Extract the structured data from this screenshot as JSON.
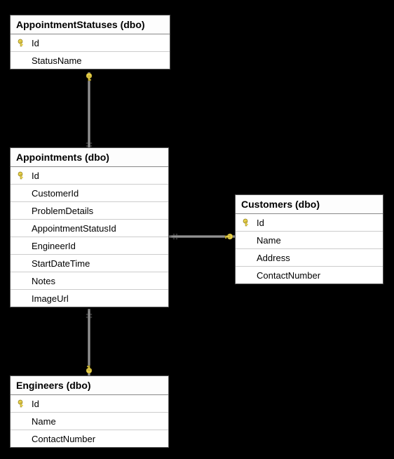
{
  "tables": {
    "appointmentStatuses": {
      "title": "AppointmentStatuses (dbo)",
      "columns": [
        {
          "name": "Id",
          "pk": true
        },
        {
          "name": "StatusName",
          "pk": false
        }
      ]
    },
    "appointments": {
      "title": "Appointments (dbo)",
      "columns": [
        {
          "name": "Id",
          "pk": true
        },
        {
          "name": "CustomerId",
          "pk": false
        },
        {
          "name": "ProblemDetails",
          "pk": false
        },
        {
          "name": "AppointmentStatusId",
          "pk": false
        },
        {
          "name": "EngineerId",
          "pk": false
        },
        {
          "name": "StartDateTime",
          "pk": false
        },
        {
          "name": "Notes",
          "pk": false
        },
        {
          "name": "ImageUrl",
          "pk": false
        }
      ]
    },
    "customers": {
      "title": "Customers (dbo)",
      "columns": [
        {
          "name": "Id",
          "pk": true
        },
        {
          "name": "Name",
          "pk": false
        },
        {
          "name": "Address",
          "pk": false
        },
        {
          "name": "ContactNumber",
          "pk": false
        }
      ]
    },
    "engineers": {
      "title": "Engineers (dbo)",
      "columns": [
        {
          "name": "Id",
          "pk": true
        },
        {
          "name": "Name",
          "pk": false
        },
        {
          "name": "ContactNumber",
          "pk": false
        }
      ]
    }
  }
}
